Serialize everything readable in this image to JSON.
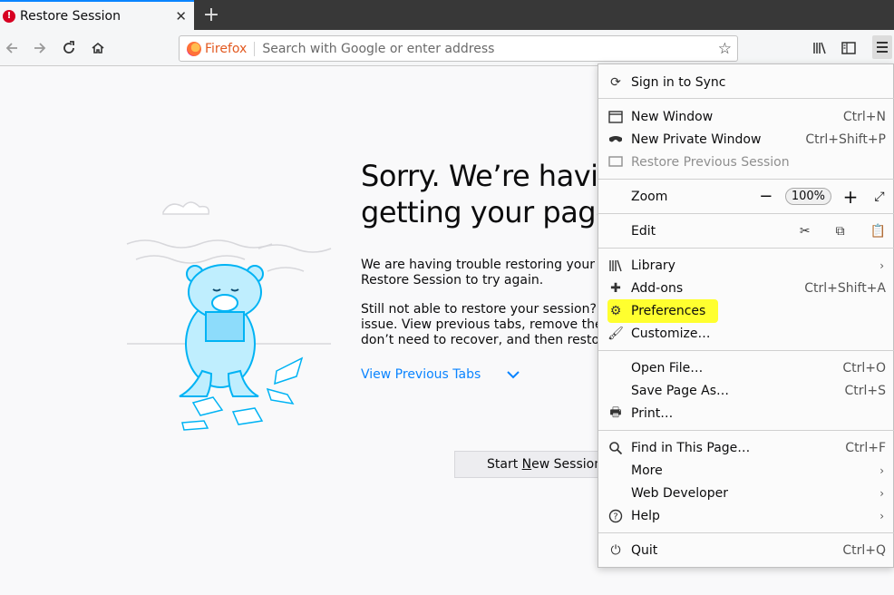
{
  "tab": {
    "title": "Restore Session",
    "close": "✕",
    "new_tab": "+"
  },
  "nav": {
    "brand": "Firefox",
    "placeholder": "Search with Google or enter address"
  },
  "page": {
    "heading_line1": "Sorry. We’re having",
    "heading_line2": "getting your pages",
    "p1_line1": "We are having trouble restoring your last",
    "p1_line2": "Restore Session to try again.",
    "p2_line1": "Still not able to restore your session? S",
    "p2_line2": "issue. View previous tabs, remove the o",
    "p2_line3": "don’t need to recover, and then restore",
    "view_previous": "View Previous Tabs",
    "start_new_pre": "Start ",
    "start_new_u": "N",
    "start_new_post": "ew Session"
  },
  "menu": {
    "sync": "Sign in to Sync",
    "new_window": "New Window",
    "new_window_sc": "Ctrl+N",
    "new_private": "New Private Window",
    "new_private_sc": "Ctrl+Shift+P",
    "restore_prev": "Restore Previous Session",
    "zoom": "Zoom",
    "zoom_minus": "−",
    "zoom_value": "100%",
    "zoom_plus": "+",
    "edit": "Edit",
    "library": "Library",
    "addons": "Add-ons",
    "addons_sc": "Ctrl+Shift+A",
    "preferences": "Preferences",
    "customize": "Customize…",
    "open_file": "Open File…",
    "open_file_sc": "Ctrl+O",
    "save_page": "Save Page As…",
    "save_page_sc": "Ctrl+S",
    "print": "Print…",
    "find": "Find in This Page…",
    "find_sc": "Ctrl+F",
    "more": "More",
    "web_dev": "Web Developer",
    "help": "Help",
    "quit": "Quit",
    "quit_sc": "Ctrl+Q"
  },
  "colors": {
    "highlight": "#ffff2f",
    "link": "#0a84ff"
  }
}
